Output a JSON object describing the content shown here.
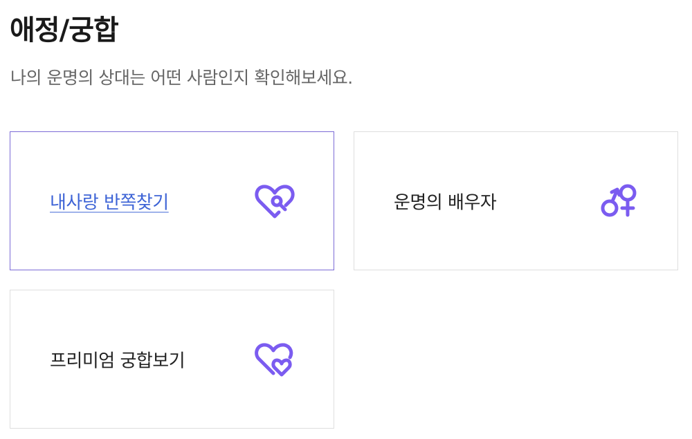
{
  "header": {
    "title": "애정/궁합",
    "subtitle": "나의 운명의 상대는 어떤 사람인지 확인해보세요."
  },
  "cards": [
    {
      "label": "내사랑 반쪽찾기",
      "icon": "heart-search-icon",
      "active": true
    },
    {
      "label": "운명의 배우자",
      "icon": "male-female-icon",
      "active": false
    },
    {
      "label": "프리미엄 궁합보기",
      "icon": "double-heart-icon",
      "active": false
    }
  ],
  "colors": {
    "accent": "#7b5cf0",
    "link": "#3e64d6",
    "active_border": "#7b6ad6",
    "border": "#dedede",
    "title": "#1a1a1a",
    "subtitle": "#666666"
  }
}
